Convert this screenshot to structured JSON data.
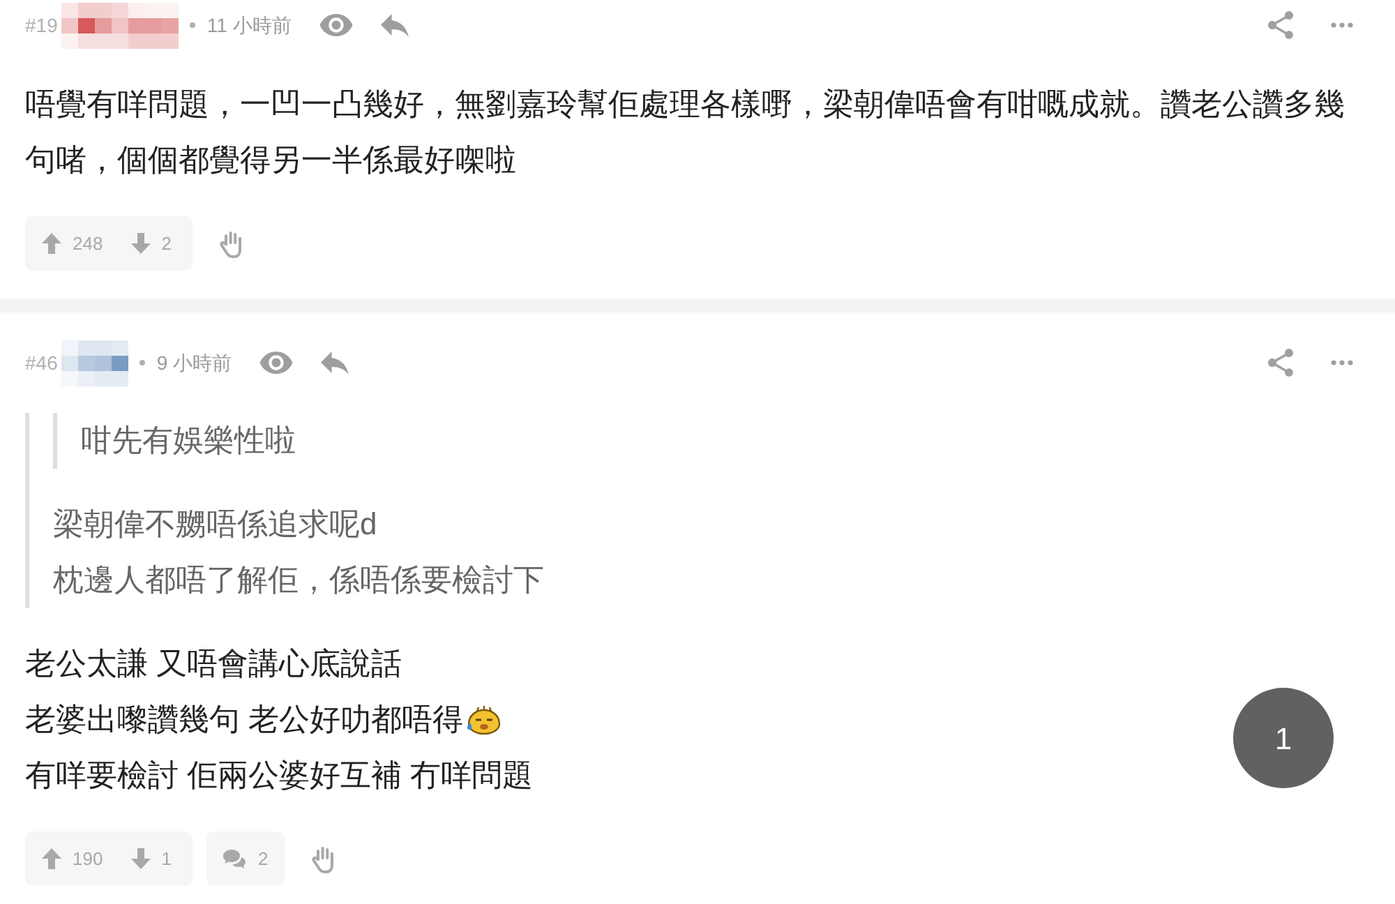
{
  "posts": [
    {
      "number": "#19",
      "color": "#d65a5a",
      "time": "11 小時前",
      "lines": [
        {
          "text": "唔覺有咩問題，一凹一凸幾好，無劉嘉玲幫佢處理各樣嘢，梁朝偉唔會有咁嘅成就。讚老公讚多幾句啫，個個都覺得另一半係最好㗎啦",
          "sticker": false
        }
      ],
      "upvotes": "248",
      "downvotes": "2"
    },
    {
      "number": "#46",
      "color": "#7a9cc2",
      "time": "9 小時前",
      "quote": {
        "quote": {
          "lines": [
            "咁先有娛樂性啦"
          ]
        },
        "lines": [
          "梁朝偉不嬲唔係追求呢d",
          "枕邊人都唔了解佢，係唔係要檢討下"
        ]
      },
      "lines": [
        {
          "text": "老公太謙 又唔會講心底說話",
          "sticker": false
        },
        {
          "text": "老婆出嚟讚幾句 老公好叻都唔得",
          "sticker": true
        },
        {
          "text": "有咩要檢討 佢兩公婆好互補 冇咩問題",
          "sticker": false
        }
      ],
      "upvotes": "190",
      "downvotes": "1",
      "comments": "2"
    }
  ],
  "page_button": {
    "label": "1"
  }
}
